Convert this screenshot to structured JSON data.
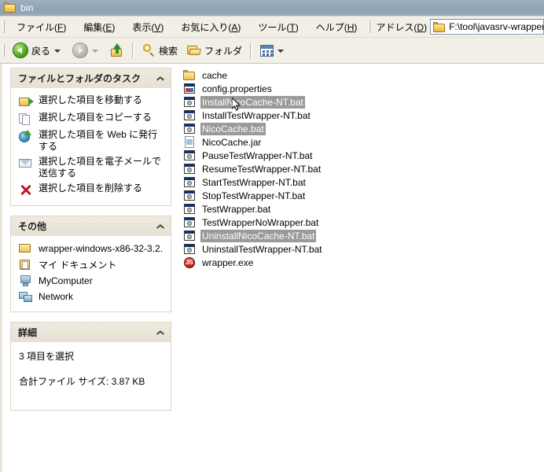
{
  "window": {
    "title": "bin",
    "title_icon": "folder-icon"
  },
  "menubar": {
    "items": [
      {
        "label": "ファイル(",
        "accel": "F",
        "tail": ")"
      },
      {
        "label": "編集(",
        "accel": "E",
        "tail": ")"
      },
      {
        "label": "表示(",
        "accel": "V",
        "tail": ")"
      },
      {
        "label": "お気に入り(",
        "accel": "A",
        "tail": ")"
      },
      {
        "label": "ツール(",
        "accel": "T",
        "tail": ")"
      },
      {
        "label": "ヘルプ(",
        "accel": "H",
        "tail": ")"
      }
    ]
  },
  "address": {
    "label": "アドレス(",
    "accel": "D",
    "label_tail": ")",
    "value": "F:\\tool\\javasrv-wrapper\\wrapper-windows-x",
    "icon": "folder-icon"
  },
  "toolbar": {
    "back_label": "戻る",
    "back_icon": "back-arrow-icon",
    "forward_icon": "forward-arrow-icon",
    "up_icon": "up-folder-icon",
    "search_label": "検索",
    "search_icon": "magnifier-icon",
    "folders_label": "フォルダ",
    "folders_icon": "open-folder-icon",
    "views_icon": "views-icon"
  },
  "sidebar": {
    "panels": [
      {
        "title": "ファイルとフォルダのタスク",
        "collapse_icon": "chevron-up-icon",
        "type": "tasks",
        "items": [
          {
            "label": "選択した項目を移動する",
            "icon": "move-item-icon"
          },
          {
            "label": "選択した項目をコピーする",
            "icon": "copy-item-icon"
          },
          {
            "label": "選択した項目を Web に発行する",
            "icon": "publish-web-icon"
          },
          {
            "label": "選択した項目を電子メールで送信する",
            "icon": "email-item-icon"
          },
          {
            "label": "選択した項目を削除する",
            "icon": "delete-item-icon"
          }
        ]
      },
      {
        "title": "その他",
        "collapse_icon": "chevron-up-icon",
        "type": "places",
        "items": [
          {
            "label": "wrapper-windows-x86-32-3.2.",
            "icon": "folder-icon"
          },
          {
            "label": "マイ ドキュメント",
            "icon": "my-documents-icon"
          },
          {
            "label": "MyComputer",
            "icon": "my-computer-icon"
          },
          {
            "label": "Network",
            "icon": "network-icon"
          }
        ]
      },
      {
        "title": "詳細",
        "collapse_icon": "chevron-up-icon",
        "type": "details",
        "lines": [
          "3 項目を選択",
          "合計ファイル サイズ: 3.87 KB"
        ]
      }
    ]
  },
  "filelist": {
    "items": [
      {
        "name": "cache",
        "icon": "folder-icon",
        "selected": false
      },
      {
        "name": "config.properties",
        "icon": "properties-file-icon",
        "selected": false
      },
      {
        "name": "InstallNicoCache-NT.bat",
        "icon": "batch-file-icon",
        "selected": true
      },
      {
        "name": "InstallTestWrapper-NT.bat",
        "icon": "batch-file-icon",
        "selected": false
      },
      {
        "name": "NicoCache.bat",
        "icon": "batch-file-icon",
        "selected": true
      },
      {
        "name": "NicoCache.jar",
        "icon": "jar-file-icon",
        "selected": false
      },
      {
        "name": "PauseTestWrapper-NT.bat",
        "icon": "batch-file-icon",
        "selected": false
      },
      {
        "name": "ResumeTestWrapper-NT.bat",
        "icon": "batch-file-icon",
        "selected": false
      },
      {
        "name": "StartTestWrapper-NT.bat",
        "icon": "batch-file-icon",
        "selected": false
      },
      {
        "name": "StopTestWrapper-NT.bat",
        "icon": "batch-file-icon",
        "selected": false
      },
      {
        "name": "TestWrapper.bat",
        "icon": "batch-file-icon",
        "selected": false
      },
      {
        "name": "TestWrapperNoWrapper.bat",
        "icon": "batch-file-icon",
        "selected": false
      },
      {
        "name": "UninstallNicoCache-NT.bat",
        "icon": "batch-file-icon",
        "selected": true
      },
      {
        "name": "UninstallTestWrapper-NT.bat",
        "icon": "batch-file-icon",
        "selected": false
      },
      {
        "name": "wrapper.exe",
        "icon": "executable-icon",
        "selected": false,
        "icon_text": "JS"
      }
    ]
  },
  "colors": {
    "titlebar": "#93a6b8",
    "panel_header": "#e6e1d3",
    "selection": "#9a9a9a",
    "toolbar_bg": "#f2efe7"
  }
}
